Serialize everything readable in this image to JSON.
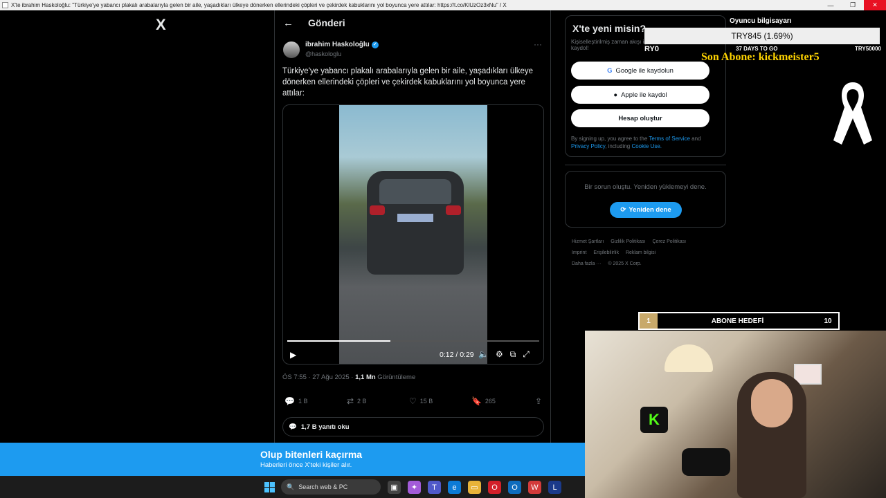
{
  "window": {
    "title": "X'te ibrahim Haskoloğlu: \"Türkiye'ye yabancı plakalı arabalarıyla gelen bir aile, yaşadıkları ülkeye dönerken ellerindeki çöpleri ve çekirdek kabuklarını yol boyunca yere attılar: https://t.co/KlUzOz3xNu\" / X"
  },
  "brand": {
    "logo_icon": "x-logo-icon",
    "logo_text": "X"
  },
  "post": {
    "page_title": "Gönderi",
    "author_name": "ibrahim Haskoloğlu",
    "author_handle": "@haskologlu",
    "text": "Türkiye'ye yabancı plakalı arabalarıyla gelen bir aile, yaşadıkları ülkeye dönerken ellerindeki çöpleri ve çekirdek kabuklarını yol boyunca yere attılar:",
    "video_time": "0:12 / 0:29",
    "video_progress": 0.41,
    "timestamp": "ÖS 7:55 · 27 Ağu 2025 · ",
    "views_count": "1,1 Mn",
    "views_label": " Görüntüleme",
    "replies": "1 B",
    "reposts": "2 B",
    "likes": "15 B",
    "bookmarks": "265",
    "read_replies": "1,7 B yanıtı oku"
  },
  "signup": {
    "title": "X'te yeni misin?",
    "subtitle": "Kişiselleştirilmiş zaman akışı için kaydol!",
    "google": "Google ile kaydolun",
    "apple": "Apple ile kaydol",
    "create": "Hesap oluştur",
    "terms_pre": "By signing up, you agree to the ",
    "terms_tos": "Terms of Service",
    "terms_and": " and ",
    "terms_pp": "Privacy Policy",
    "terms_incl": ", including ",
    "terms_cookie": "Cookie Use."
  },
  "error": {
    "message": "Bir sorun oluştu. Yeniden yüklemeyi dene.",
    "retry": "Yeniden dene"
  },
  "footer": {
    "links": [
      "Hizmet Şartları",
      "Gizlilik Politikası",
      "Çerez Politikası",
      "Imprint",
      "Erişilebilirlik",
      "Reklam bilgisi",
      "Daha fazla ···",
      "© 2025 X Corp."
    ]
  },
  "overlay": {
    "title": "Oyuncu bilgisayarı",
    "amount": "TRY845 (1.69%)",
    "start": "RY0",
    "days": "37 DAYS TO GO",
    "goal": "TRY50000",
    "last_sub": "Son Abone: kickmeister5",
    "sub_goal_current": "1",
    "sub_goal_label": "ABONE HEDEFİ",
    "sub_goal_target": "10"
  },
  "banner": {
    "title": "Olup bitenleri kaçırma",
    "subtitle": "Haberleri önce X'teki kişiler alır."
  },
  "taskbar": {
    "search_placeholder": "Search web & PC"
  },
  "colors": {
    "accent": "#1d9bf0",
    "background": "#000000",
    "text_muted": "#71767b"
  }
}
